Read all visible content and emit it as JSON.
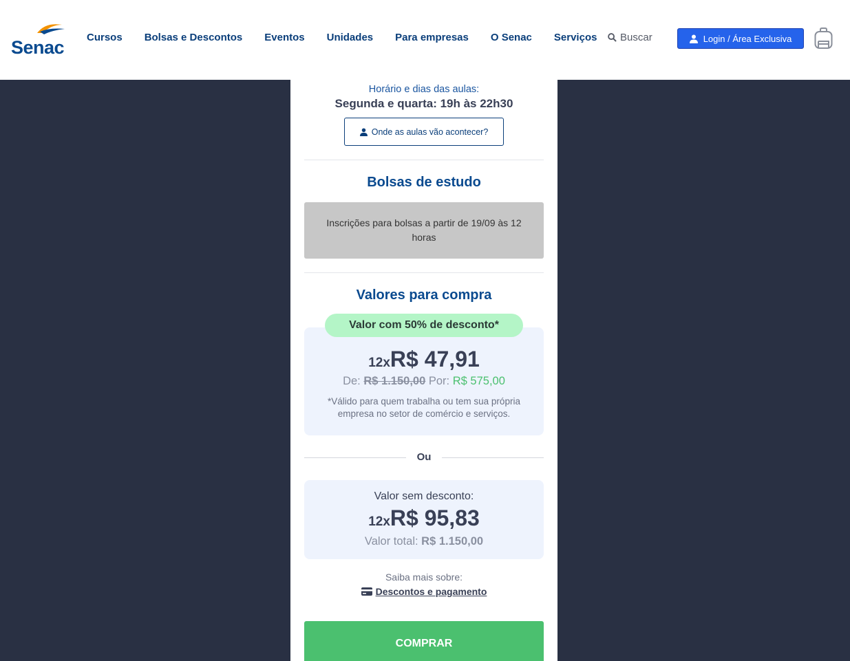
{
  "header": {
    "logo_text": "Senac",
    "nav": [
      "Cursos",
      "Bolsas e Descontos",
      "Eventos",
      "Unidades",
      "Para empresas",
      "O Senac",
      "Serviços"
    ],
    "search_label": "Buscar",
    "login_label": "Login / Área Exclusiva"
  },
  "schedule": {
    "label": "Horário e dias das aulas:",
    "value": "Segunda e quarta: 19h às 22h30",
    "where_button": "Onde as aulas vão acontecer?"
  },
  "bolsas": {
    "title": "Bolsas de estudo",
    "message": "Inscrições para bolsas a partir de 19/09 às 12 horas"
  },
  "valores": {
    "title": "Valores para compra",
    "discount_pill": "Valor com 50% de desconto*",
    "discount": {
      "installments": "12x",
      "amount": "R$ 47,91",
      "de_label": "De:",
      "de_value": "R$ 1.150,00",
      "por_label": "Por:",
      "por_value": "R$ 575,00",
      "note": "*Válido para quem trabalha ou tem sua própria empresa no setor de comércio e serviços."
    },
    "ou": "Ou",
    "full": {
      "label": "Valor sem desconto:",
      "installments": "12x",
      "amount": "R$ 95,83",
      "total_label": "Valor total:",
      "total_value": "R$ 1.150,00"
    },
    "saiba": "Saiba mais sobre:",
    "link": "Descontos e pagamento",
    "buy": "COMPRAR"
  },
  "colors": {
    "brand_blue": "#0a4a8f",
    "login_blue": "#2563eb",
    "buy_green": "#4bc06f",
    "background": "#293043"
  }
}
